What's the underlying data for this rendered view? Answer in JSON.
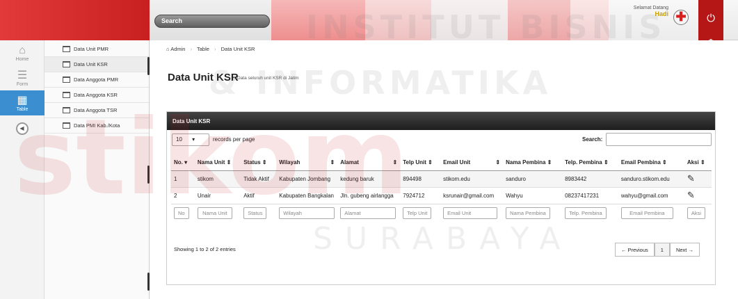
{
  "topbar": {
    "search_label": "Search",
    "welcome_text": "Selamat Datang",
    "user_name": "Hadi",
    "power_glyph": "⏻"
  },
  "rail": {
    "items": [
      {
        "label": "Home",
        "icon": "home-icon"
      },
      {
        "label": "Form",
        "icon": "list-icon"
      },
      {
        "label": "Table",
        "icon": "table-icon"
      }
    ]
  },
  "submenu": {
    "items": [
      "Data Unit PMR",
      "Data Unit KSR",
      "Data Anggota PMR",
      "Data Anggota KSR",
      "Data Anggota TSR",
      "Data PMI Kab./Kota"
    ]
  },
  "breadcrumb": [
    "Admin",
    "Table",
    "Data Unit KSR"
  ],
  "page": {
    "title": "Data Unit KSR",
    "subtitle": "Data seluruh unit KSR di Jatim"
  },
  "panel": {
    "title": "Data Unit KSR",
    "length_value": "10",
    "length_label": "records per page",
    "search_label": "Search:",
    "columns": [
      "No.",
      "Nama Unit",
      "Status",
      "Wilayah",
      "Alamat",
      "Telp Unit",
      "Email Unit",
      "Nama Pembina",
      "Telp. Pembina",
      "Email Pembina",
      "Aksi"
    ],
    "rows": [
      [
        "1",
        "stikom",
        "Tidak Aktif",
        "Kabupaten Jombang",
        "kedung baruk",
        "894498",
        "stikom.edu",
        "sanduro",
        "8983442",
        "sanduro.stikom.edu"
      ],
      [
        "2",
        "Unair",
        "Aktif",
        "Kabupaten Bangkalan",
        "Jln. gubeng airlangga",
        "7924712",
        "ksrunair@gmail.com",
        "Wahyu",
        "08237417231",
        "wahyu@gmail.com"
      ]
    ],
    "filters": [
      "No",
      "Nama Unit",
      "Status",
      "Wilayah",
      "Alamat",
      "Telp Unit",
      "Email Unit",
      "Nama Pembina",
      "Telp. Pembina",
      "Email Pembina",
      "Aksi"
    ],
    "info": "Showing 1 to 2 of 2 entries",
    "pager": {
      "prev": "← Previous",
      "page": "1",
      "next": "Next →"
    }
  },
  "watermark": {
    "line1": "INSTITUT BISNIS",
    "line2": "& INFORMATIKA",
    "logo": "stikom",
    "line3": "SURABAYA"
  }
}
